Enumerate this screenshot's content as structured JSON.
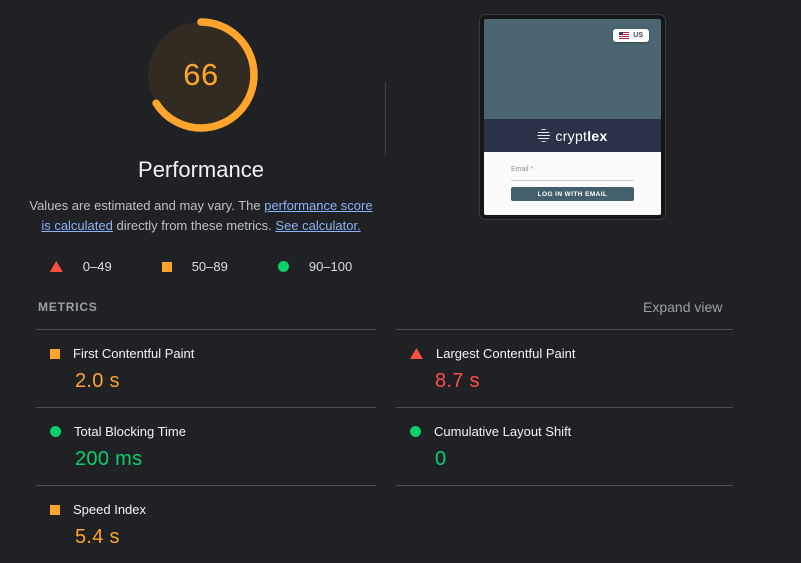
{
  "theme": {
    "background": "#202124",
    "pass_color": "#0cce6b",
    "average_color": "#ffa42c",
    "fail_color": "#ff4e42",
    "link_color": "#8ab4f8",
    "gauge_arc_color": "#ffa42c"
  },
  "gauge": {
    "score": 66,
    "label": "Performance"
  },
  "disclaimer": {
    "text1": "Values are estimated and may vary. The ",
    "link1": "performance score is calculated",
    "text2": " directly from these metrics. ",
    "link2": "See calculator."
  },
  "legend": {
    "items": [
      {
        "icon": "triangle-icon",
        "label": "0–49",
        "color": "#ff4e42"
      },
      {
        "icon": "square-icon",
        "label": "50–89",
        "color": "#ffa42c"
      },
      {
        "icon": "circle-icon",
        "label": "90–100",
        "color": "#0cce6b"
      }
    ]
  },
  "metrics_section": {
    "title": "METRICS",
    "expand_label": "Expand view",
    "items": [
      {
        "label": "First Contentful Paint",
        "value": "2.0 s",
        "rating": "average",
        "color": "#ffa42c"
      },
      {
        "label": "Largest Contentful Paint",
        "value": "8.7 s",
        "rating": "fail",
        "color": "#ff4e42"
      },
      {
        "label": "Total Blocking Time",
        "value": "200 ms",
        "rating": "pass",
        "color": "#0cce6b"
      },
      {
        "label": "Cumulative Layout Shift",
        "value": "0",
        "rating": "pass",
        "color": "#0cce6b"
      },
      {
        "label": "Speed Index",
        "value": "5.4 s",
        "rating": "average",
        "color": "#ffa42c"
      }
    ]
  },
  "screenshot_thumbnail": {
    "locale_chip": "US",
    "brand_prefix": "crypt",
    "brand_suffix": "lex",
    "email_label": "Email *",
    "login_button": "LOG IN WITH EMAIL"
  }
}
